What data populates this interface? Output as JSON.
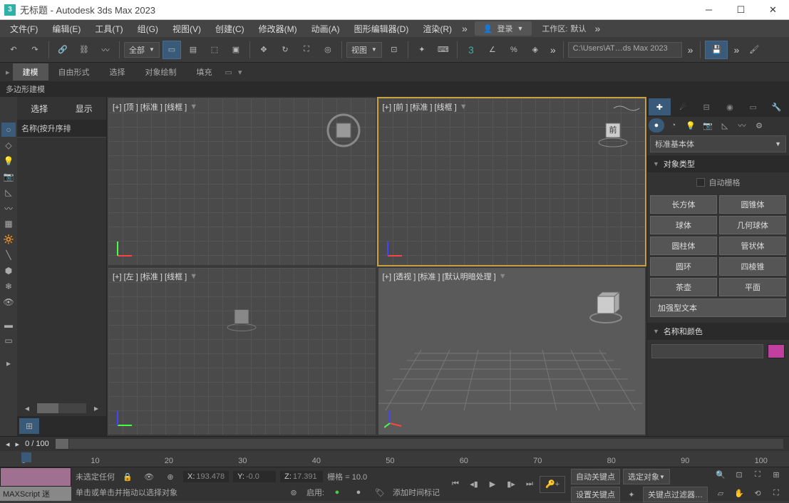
{
  "title": "无标题 - Autodesk 3ds Max 2023",
  "app_icon": "3",
  "menus": [
    "文件(F)",
    "编辑(E)",
    "工具(T)",
    "组(G)",
    "视图(V)",
    "创建(C)",
    "修改器(M)",
    "动画(A)",
    "图形编辑器(D)",
    "渲染(R)"
  ],
  "login": "登录",
  "workspace_label": "工作区:",
  "workspace_value": "默认",
  "toolbar_dropdown": "全部",
  "toolbar_viewport": "视图",
  "project_path": "C:\\Users\\AT…ds Max 2023",
  "tabs2": [
    "建模",
    "自由形式",
    "选择",
    "对象绘制",
    "填充"
  ],
  "ribbon_label": "多边形建模",
  "left": {
    "tabs": [
      "选择",
      "显示"
    ],
    "header": "名称(按升序排"
  },
  "viewports": {
    "top": "[+] [顶 ] [标准 ] [线框 ]",
    "front": "[+] [前 ] [标准 ] [线框 ]",
    "left": "[+] [左 ] [标准 ] [线框 ]",
    "persp": "[+] [透视 ] [标准 ] [默认明暗处理 ]"
  },
  "right": {
    "dropdown": "标准基本体",
    "section1": "对象类型",
    "autogrid": "自动栅格",
    "objects": [
      "长方体",
      "圆锥体",
      "球体",
      "几何球体",
      "圆柱体",
      "管状体",
      "圆环",
      "四棱锥",
      "茶壶",
      "平面",
      "加强型文本"
    ],
    "section2": "名称和颜色"
  },
  "timeline": {
    "frame": "0",
    "total": "100",
    "ticks": [
      "0",
      "10",
      "20",
      "30",
      "40",
      "50",
      "60",
      "70",
      "80",
      "90",
      "100"
    ]
  },
  "status": {
    "script": "MAXScript 迷",
    "selection": "未选定任何",
    "prompt": "单击或单击并拖动以选择对象",
    "x_label": "X:",
    "x_val": "193.478",
    "y_label": "Y:",
    "y_val": "-0.0",
    "z_label": "Z:",
    "z_val": "17.391",
    "grid_label": "栅格 = 10.0",
    "enable": "启用:",
    "timetag": "添加时间标记",
    "autokey": "自动关键点",
    "setkey": "设置关键点",
    "selected": "选定对象",
    "keyfilter": "关键点过滤器…"
  }
}
